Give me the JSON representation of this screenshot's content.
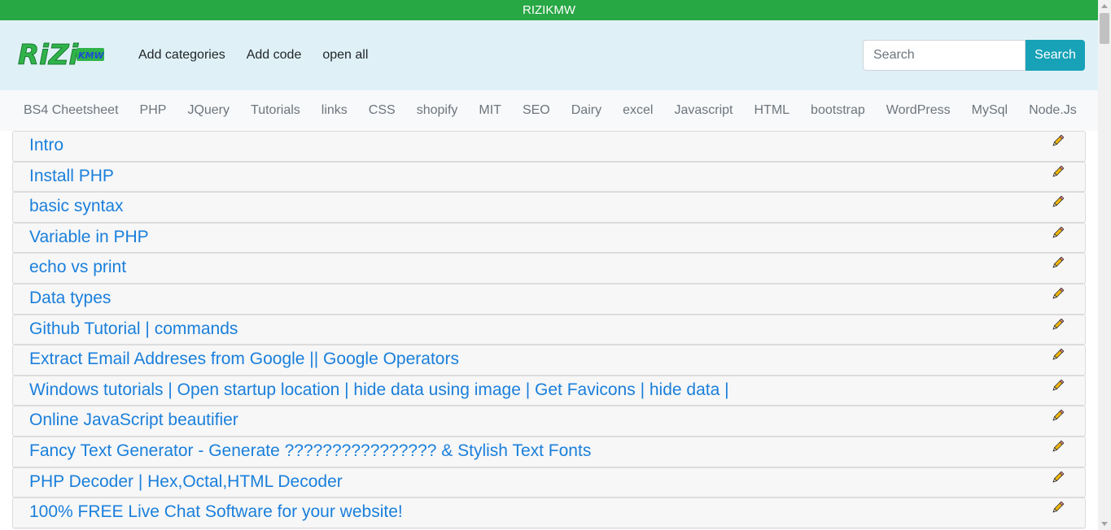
{
  "topbar": {
    "title": "RIZIKMW"
  },
  "logo": {
    "main": "RiZi",
    "sub": "KMW"
  },
  "nav": {
    "links": [
      "Add categories",
      "Add code",
      "open all"
    ]
  },
  "search": {
    "placeholder": "Search",
    "button_label": "Search"
  },
  "categories": [
    "BS4 Cheetsheet",
    "PHP",
    "JQuery",
    "Tutorials",
    "links",
    "CSS",
    "shopify",
    "MIT",
    "SEO",
    "Dairy",
    "excel",
    "Javascript",
    "HTML",
    "bootstrap",
    "WordPress",
    "MySql",
    "Node.Js"
  ],
  "items": [
    "Intro",
    "Install PHP",
    "basic syntax",
    "Variable in PHP",
    "echo vs print",
    "Data types",
    "Github Tutorial | commands",
    "Extract Email Addreses from Google || Google Operators",
    "Windows tutorials | Open startup location | hide data using image | Get Favicons | hide data |",
    "Online JavaScript beautifier",
    "Fancy Text Generator - Generate ???????????????? & Stylish Text Fonts",
    "PHP Decoder | Hex,Octal,HTML Decoder",
    "100% FREE Live Chat Software for your website!"
  ],
  "colors": {
    "topbar": "#28a745",
    "navbar": "#dff1f7",
    "link": "#1a7fdb",
    "search_button": "#17a2b8"
  },
  "icons": {
    "edit": "pencil-icon"
  }
}
